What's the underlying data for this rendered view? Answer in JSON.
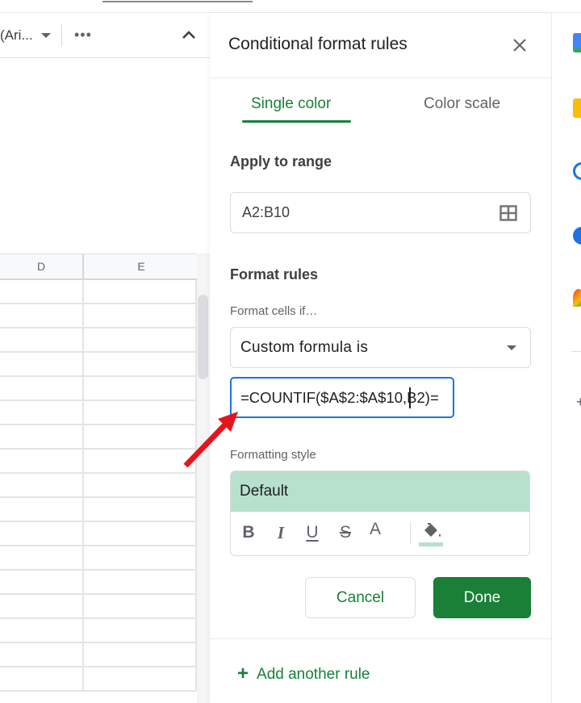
{
  "sheet": {
    "toolbar": {
      "font_name": "(Ari...",
      "more_label": "•••"
    },
    "columns": [
      "D",
      "E"
    ],
    "row_count": 17
  },
  "panel": {
    "title": "Conditional format rules",
    "tabs": [
      {
        "label": "Single color",
        "active": true
      },
      {
        "label": "Color scale",
        "active": false
      }
    ],
    "apply_to_range": {
      "label": "Apply to range",
      "value": "A2:B10"
    },
    "format_rules": {
      "label": "Format rules",
      "condition_label": "Format cells if…",
      "condition_value": "Custom formula is",
      "formula_value": "=COUNTIF($A$2:$A$10,B2)="
    },
    "formatting_style": {
      "label": "Formatting style",
      "preview_text": "Default",
      "fill_color": "#b7e1cd",
      "tools": [
        "bold",
        "italic",
        "underline",
        "strikethrough",
        "text-color",
        "fill-color"
      ]
    },
    "buttons": {
      "cancel": "Cancel",
      "done": "Done"
    },
    "add_rule_label": "Add another rule"
  },
  "side_rail": {
    "apps": [
      "calendar",
      "keep",
      "tasks",
      "contacts",
      "maps"
    ],
    "add_label": "+"
  },
  "colors": {
    "accent_green": "#188038",
    "done_button": "#1a7f37",
    "focus_blue": "#1a73e8",
    "annotation_red": "#e8141b"
  }
}
